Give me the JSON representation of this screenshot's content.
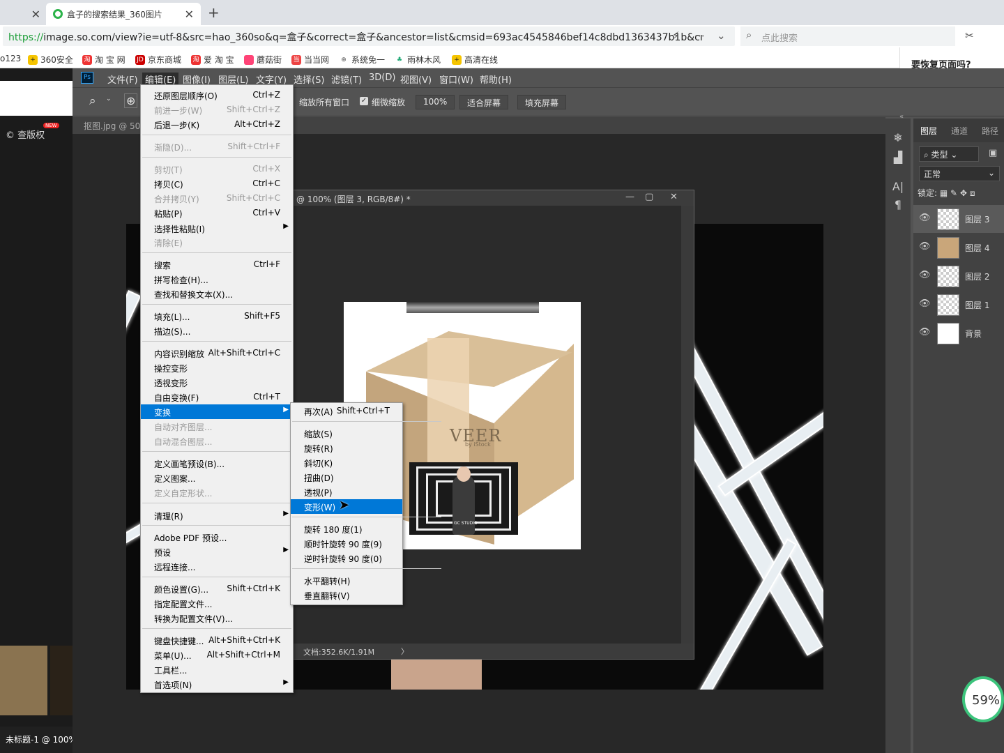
{
  "browser": {
    "tabs": [
      {
        "label": ""
      },
      {
        "label": "盒子的搜索结果_360图片"
      }
    ],
    "url_protocol": "https://",
    "url_rest": "image.so.com/view?ie=utf-8&src=hao_360so&q=盒子&correct=盒子&ancestor=list&cmsid=693ac4545846bef14c8dbd1363437b1b&cı",
    "search_placeholder": "点此搜索",
    "bookmarks": [
      "o123",
      "360安全",
      "淘 宝 网",
      "京东商城",
      "爱 淘 宝",
      "蘑菇街",
      "当当网",
      "系统免一",
      "雨林木风",
      "高清在线"
    ],
    "restore_prompt": "要恢复页面吗?",
    "left_strip_text": "查版权",
    "left_strip_badge": "NEW",
    "taskbar_item": "未标题-1 @ 100%",
    "progress_badge": "59%"
  },
  "photoshop": {
    "menu_bar": [
      "文件(F)",
      "编辑(E)",
      "图像(I)",
      "图层(L)",
      "文字(Y)",
      "选择(S)",
      "滤镜(T)",
      "3D(D)",
      "视图(V)",
      "窗口(W)",
      "帮助(H)"
    ],
    "options": {
      "resize_all": "缩放所有窗口",
      "scrubby_zoom": "细微缩放",
      "zoom_value": "100%",
      "fit_screen": "适合屏幕",
      "fill_screen": "填充屏幕"
    },
    "doc_tab": "抠图.jpg @ 50",
    "float_title": "@ 100% (图层 3, RGB/8#) *",
    "float_status": "文档:352.6K/1.91M",
    "edit_menu": [
      {
        "label": "还原图层顺序(O)",
        "shortcut": "Ctrl+Z"
      },
      {
        "label": "前进一步(W)",
        "shortcut": "Shift+Ctrl+Z"
      },
      {
        "label": "后退一步(K)",
        "shortcut": "Alt+Ctrl+Z"
      },
      {
        "label": "渐隐(D)...",
        "shortcut": "Shift+Ctrl+F"
      },
      {
        "label": "剪切(T)",
        "shortcut": "Ctrl+X"
      },
      {
        "label": "拷贝(C)",
        "shortcut": "Ctrl+C"
      },
      {
        "label": "合并拷贝(Y)",
        "shortcut": "Shift+Ctrl+C"
      },
      {
        "label": "粘贴(P)",
        "shortcut": "Ctrl+V"
      },
      {
        "label": "选择性粘贴(I)",
        "shortcut": ""
      },
      {
        "label": "清除(E)",
        "shortcut": ""
      },
      {
        "label": "搜索",
        "shortcut": "Ctrl+F"
      },
      {
        "label": "拼写检查(H)...",
        "shortcut": ""
      },
      {
        "label": "查找和替换文本(X)...",
        "shortcut": ""
      },
      {
        "label": "填充(L)...",
        "shortcut": "Shift+F5"
      },
      {
        "label": "描边(S)...",
        "shortcut": ""
      },
      {
        "label": "内容识别缩放",
        "shortcut": "Alt+Shift+Ctrl+C"
      },
      {
        "label": "操控变形",
        "shortcut": ""
      },
      {
        "label": "透视变形",
        "shortcut": ""
      },
      {
        "label": "自由变换(F)",
        "shortcut": "Ctrl+T"
      },
      {
        "label": "变换",
        "shortcut": ""
      },
      {
        "label": "自动对齐图层...",
        "shortcut": ""
      },
      {
        "label": "自动混合图层...",
        "shortcut": ""
      },
      {
        "label": "定义画笔预设(B)...",
        "shortcut": ""
      },
      {
        "label": "定义图案...",
        "shortcut": ""
      },
      {
        "label": "定义自定形状...",
        "shortcut": ""
      },
      {
        "label": "清理(R)",
        "shortcut": ""
      },
      {
        "label": "Adobe PDF 预设...",
        "shortcut": ""
      },
      {
        "label": "预设",
        "shortcut": ""
      },
      {
        "label": "远程连接...",
        "shortcut": ""
      },
      {
        "label": "颜色设置(G)...",
        "shortcut": "Shift+Ctrl+K"
      },
      {
        "label": "指定配置文件...",
        "shortcut": ""
      },
      {
        "label": "转换为配置文件(V)...",
        "shortcut": ""
      },
      {
        "label": "键盘快捷键...",
        "shortcut": "Alt+Shift+Ctrl+K"
      },
      {
        "label": "菜单(U)...",
        "shortcut": "Alt+Shift+Ctrl+M"
      },
      {
        "label": "工具栏...",
        "shortcut": ""
      },
      {
        "label": "首选项(N)",
        "shortcut": ""
      }
    ],
    "transform_submenu": [
      {
        "label": "再次(A)",
        "shortcut": "Shift+Ctrl+T"
      },
      {
        "label": "缩放(S)",
        "shortcut": ""
      },
      {
        "label": "旋转(R)",
        "shortcut": ""
      },
      {
        "label": "斜切(K)",
        "shortcut": ""
      },
      {
        "label": "扭曲(D)",
        "shortcut": ""
      },
      {
        "label": "透视(P)",
        "shortcut": ""
      },
      {
        "label": "变形(W)",
        "shortcut": ""
      },
      {
        "label": "旋转 180 度(1)",
        "shortcut": ""
      },
      {
        "label": "顺时针旋转 90 度(9)",
        "shortcut": ""
      },
      {
        "label": "逆时针旋转 90 度(0)",
        "shortcut": ""
      },
      {
        "label": "水平翻转(H)",
        "shortcut": ""
      },
      {
        "label": "垂直翻转(V)",
        "shortcut": ""
      }
    ],
    "artwork": {
      "brand": "VEER",
      "brand_sub": "by iStock",
      "photo_caption": "GC STUDIO"
    },
    "panel_tabs": [
      "图层",
      "通道",
      "路径"
    ],
    "layer_filter": "类型",
    "blend_mode": "正常",
    "lock_label": "锁定:",
    "layers": [
      {
        "name": "图层 3",
        "selected": true
      },
      {
        "name": "图层 4",
        "selected": false
      },
      {
        "name": "图层 2",
        "selected": false
      },
      {
        "name": "图层 1",
        "selected": false
      },
      {
        "name": "背景",
        "selected": false
      }
    ]
  }
}
